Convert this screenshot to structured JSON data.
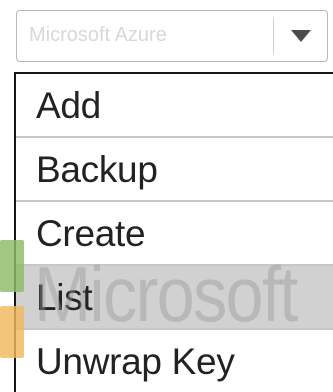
{
  "select": {
    "value": "Microsoft Azure"
  },
  "dropdown": {
    "items": [
      {
        "label": "Add",
        "selected": false
      },
      {
        "label": "Backup",
        "selected": false
      },
      {
        "label": "Create",
        "selected": false
      },
      {
        "label": "List",
        "selected": true
      },
      {
        "label": "Unwrap Key",
        "selected": false
      }
    ]
  },
  "watermark": {
    "text": "Microsoft"
  },
  "colors": {
    "selected_item_background": "#d1d1d1",
    "list_border": "#161616",
    "item_separator": "#c7c7c7",
    "watermark_green": "#8dbb68",
    "watermark_orange": "#f0b85d"
  },
  "icons": {
    "dropdown_arrow": "chevron-down-icon",
    "watermark_logo": "microsoft-logo-icon"
  }
}
